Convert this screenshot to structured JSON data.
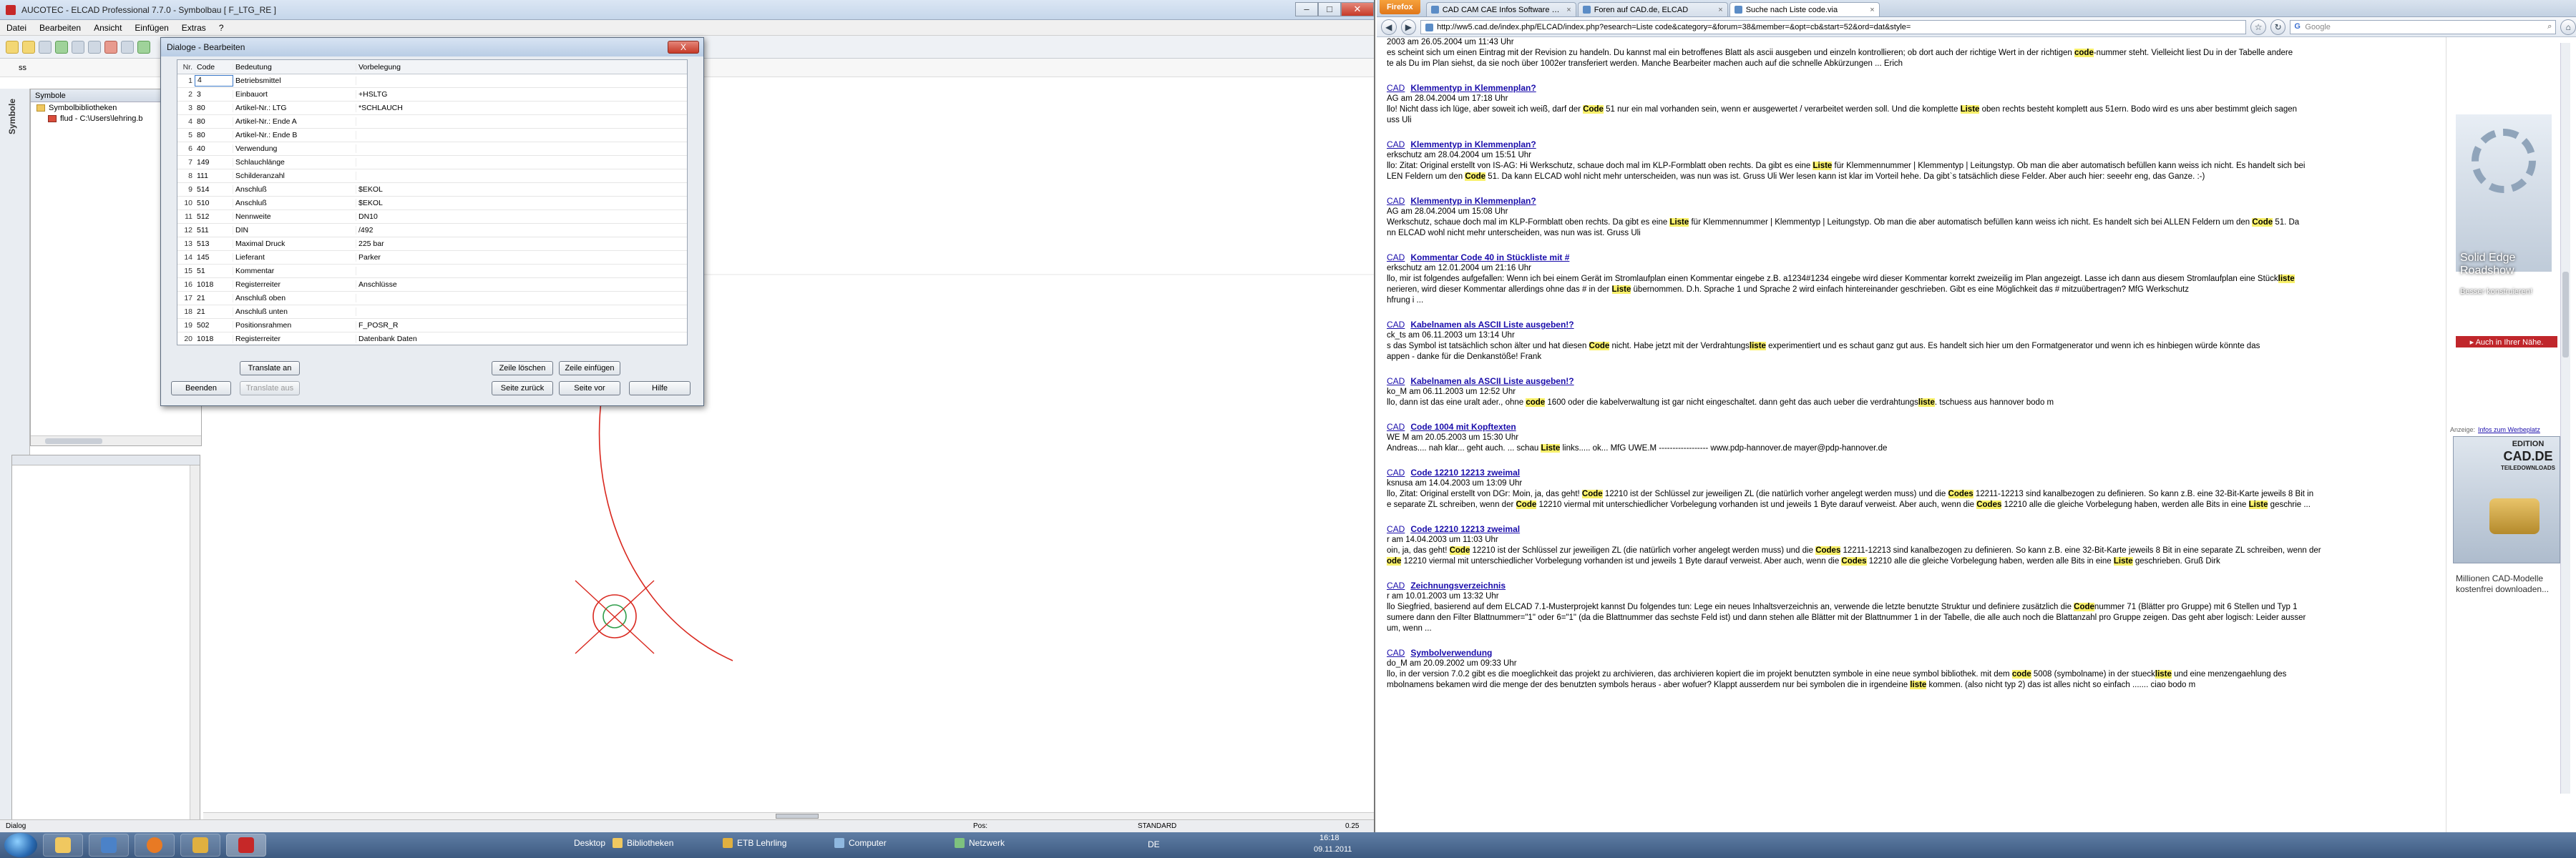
{
  "elcad": {
    "title": "AUCOTEC - ELCAD Professional 7.7.0 - Symbolbau [ F_LTG_RE ]",
    "menu": [
      "Datei",
      "Bearbeiten",
      "Ansicht",
      "Einfügen",
      "Extras",
      "?"
    ],
    "search_value": "ss",
    "left_tab": "Symbole",
    "sym_panel_title": "Symbole",
    "tree": [
      "Symbolbibliotheken",
      "flud - C:\\Users\\lehring.b"
    ],
    "status_left": "Dialog",
    "status_mid": "Pos:",
    "status_std": "STANDARD",
    "status_zoom": "0.25"
  },
  "dialog": {
    "title": "Dialoge - Bearbeiten",
    "close_label": "X",
    "columns": [
      "Nr.",
      "Code",
      "Bedeutung",
      "Vorbelegung"
    ],
    "rows": [
      {
        "nr": "1",
        "code": "4",
        "bed": "Betriebsmittel",
        "vor": ""
      },
      {
        "nr": "2",
        "code": "3",
        "bed": "Einbauort",
        "vor": "+HSLTG"
      },
      {
        "nr": "3",
        "code": "80",
        "bed": "Artikel-Nr.: LTG",
        "vor": "*SCHLAUCH"
      },
      {
        "nr": "4",
        "code": "80",
        "bed": "Artikel-Nr.: Ende A",
        "vor": ""
      },
      {
        "nr": "5",
        "code": "80",
        "bed": "Artikel-Nr.: Ende B",
        "vor": ""
      },
      {
        "nr": "6",
        "code": "40",
        "bed": "Verwendung",
        "vor": ""
      },
      {
        "nr": "7",
        "code": "149",
        "bed": "Schlauchlänge",
        "vor": ""
      },
      {
        "nr": "8",
        "code": "111",
        "bed": "Schilderanzahl",
        "vor": ""
      },
      {
        "nr": "9",
        "code": "514",
        "bed": "Anschluß",
        "vor": "$EKOL"
      },
      {
        "nr": "10",
        "code": "510",
        "bed": "Anschluß",
        "vor": "$EKOL"
      },
      {
        "nr": "11",
        "code": "512",
        "bed": "Nennweite",
        "vor": "DN10"
      },
      {
        "nr": "12",
        "code": "511",
        "bed": "DIN",
        "vor": "/492"
      },
      {
        "nr": "13",
        "code": "513",
        "bed": "Maximal Druck",
        "vor": "225 bar"
      },
      {
        "nr": "14",
        "code": "145",
        "bed": "Lieferant",
        "vor": "Parker"
      },
      {
        "nr": "15",
        "code": "51",
        "bed": "Kommentar",
        "vor": ""
      },
      {
        "nr": "16",
        "code": "1018",
        "bed": "Registerreiter",
        "vor": "Anschlüsse"
      },
      {
        "nr": "17",
        "code": "21",
        "bed": "Anschluß oben",
        "vor": ""
      },
      {
        "nr": "18",
        "code": "21",
        "bed": "Anschluß unten",
        "vor": ""
      },
      {
        "nr": "19",
        "code": "502",
        "bed": "Positionsrahmen",
        "vor": "F_POSR_R"
      },
      {
        "nr": "20",
        "code": "1018",
        "bed": "Registerreiter",
        "vor": "Datenbank Daten"
      }
    ],
    "buttons": {
      "translate_an": "Translate an",
      "zeile_loeschen": "Zeile löschen",
      "zeile_einfuegen": "Zeile einfügen",
      "beenden": "Beenden",
      "translate_aus": "Translate aus",
      "seite_zurueck": "Seite zurück",
      "seite_vor": "Seite vor",
      "hilfe": "Hilfe"
    }
  },
  "browser": {
    "firefox_label": "Firefox",
    "tabs": [
      {
        "label": "CAD CAM CAE Infos Software und Fo...",
        "active": false
      },
      {
        "label": "Foren auf CAD.de, ELCAD",
        "active": false
      },
      {
        "label": "Suche nach Liste code.via",
        "active": true
      }
    ],
    "url": "http://ww5.cad.de/index.php/ELCAD/index.php?esearch=Liste code&category=&forum=38&member=&opt=cb&start=52&ord=dat&style=",
    "search_placeholder": "Google",
    "results": [
      {
        "src": "",
        "link": "",
        "meta": "2003 am 26.05.2004 um 11:43 Uhr",
        "body": [
          [
            {
              "t": "es scheint sich um einen Eintrag mit der Revision zu handeln. Du kannst mal ein betroffenes Blatt als ascii ausgeben und einzeln kontrollieren; ob dort auch der richtige Wert in der richtigen "
            },
            {
              "t": "code",
              "h": true
            },
            {
              "t": "-nummer steht. Vielleicht liest Du in der Tabelle andere"
            }
          ],
          [
            {
              "t": "te als Du im Plan siehst, da sie noch über 1002er transferiert werden. Manche Bearbeiter machen auch auf die schnelle Abkürzungen ... Erich"
            }
          ]
        ]
      },
      {
        "src": "CAD",
        "link": "Klemmentyp in Klemmenplan?",
        "meta": "AG am 28.04.2004 um 17:18 Uhr",
        "body": [
          [
            {
              "t": "llo! Nicht dass ich lüge, aber soweit ich weiß, darf der "
            },
            {
              "t": "Code",
              "h": true
            },
            {
              "t": " 51 nur ein mal vorhanden sein, wenn er ausgewertet / verarbeitet werden soll. Und die komplette "
            },
            {
              "t": "Liste",
              "h": true
            },
            {
              "t": " oben rechts besteht komplett aus 51ern. Bodo wird es uns aber bestimmt gleich sagen"
            }
          ],
          [
            {
              "t": "uss Uli"
            }
          ]
        ]
      },
      {
        "src": "CAD",
        "link": "Klemmentyp in Klemmenplan?",
        "meta": "erkschutz am 28.04.2004 um 15:51 Uhr",
        "body": [
          [
            {
              "t": "llo: Zitat: Original erstellt von IS-AG: Hi Werkschutz, schaue doch mal im KLP-Formblatt oben rechts.  Da gibt es eine "
            },
            {
              "t": "Liste",
              "h": true
            },
            {
              "t": " für Klemmennummer | Klemmentyp | Leitungstyp. Ob man die aber automatisch befüllen kann weiss ich nicht. Es handelt sich bei"
            }
          ],
          [
            {
              "t": "LEN Feldern um den "
            },
            {
              "t": "Code",
              "h": true
            },
            {
              "t": " 51. Da kann ELCAD wohl nicht mehr unterscheiden, was nun was ist. Gruss Uli Wer lesen kann ist klar im Vorteil hehe. Da gibt`s tatsächlich diese Felder. Aber auch hier: seeehr eng, das Ganze. :-)"
            }
          ]
        ]
      },
      {
        "src": "CAD",
        "link": "Klemmentyp in Klemmenplan?",
        "meta": "AG am 28.04.2004 um 15:08 Uhr",
        "body": [
          [
            {
              "t": "Werkschutz, schaue doch mal im KLP-Formblatt oben rechts.  Da gibt es eine "
            },
            {
              "t": "Liste",
              "h": true
            },
            {
              "t": " für Klemmennummer | Klemmentyp | Leitungstyp. Ob man die aber automatisch befüllen kann weiss ich nicht. Es handelt sich bei ALLEN Feldern um den "
            },
            {
              "t": "Code",
              "h": true
            },
            {
              "t": " 51. Da"
            }
          ],
          [
            {
              "t": "nn ELCAD wohl nicht mehr unterscheiden, was nun was ist. Gruss Uli"
            }
          ]
        ]
      },
      {
        "src": "CAD",
        "link": "Kommentar Code 40 in Stückliste mit #",
        "meta": "erkschutz am 12.01.2004 um 21:16 Uhr",
        "body": [
          [
            {
              "t": "llo, mir ist folgendes aufgefallen: Wenn ich bei einem Gerät im Stromlaufplan einen Kommentar eingebe z.B. a1234#1234 eingebe wird dieser Kommentar korrekt zweizeilig im Plan angezeigt. Lasse ich dann aus diesem Stromlaufplan eine Stück"
            },
            {
              "t": "liste",
              "h": true
            }
          ],
          [
            {
              "t": "nerieren, wird dieser Kommentar allerdings ohne das # in der "
            },
            {
              "t": "Liste",
              "h": true
            },
            {
              "t": " übernommen. D.h. Sprache 1 und Sprache 2 wird einfach hintereinander geschrieben. Gibt es eine Möglichkeit das # mitzuübertragen? MfG Werkschutz"
            }
          ],
          [
            {
              "t": "hfrung i ..."
            }
          ]
        ]
      },
      {
        "src": "CAD",
        "link": "Kabelnamen als ASCII Liste ausgeben!?",
        "meta": "ck_ts am 06.11.2003 um 13:14 Uhr",
        "body": [
          [
            {
              "t": "s das Symbol ist tatsächlich schon älter und hat diesen "
            },
            {
              "t": "Code",
              "h": true
            },
            {
              "t": " nicht. Habe jetzt mit der Verdrahtungs"
            },
            {
              "t": "liste",
              "h": true
            },
            {
              "t": " experimentiert und es schaut ganz gut aus. Es handelt sich hier um den Formatgenerator und wenn ich es hinbiegen würde könnte das"
            }
          ],
          [
            {
              "t": "appen - danke für die Denkanstöße! Frank"
            }
          ]
        ]
      },
      {
        "src": "CAD",
        "link": "Kabelnamen als ASCII Liste ausgeben!?",
        "meta": "ko_M am 06.11.2003 um 12:52 Uhr",
        "body": [
          [
            {
              "t": "llo, dann ist das eine uralt ader., ohne "
            },
            {
              "t": "code",
              "h": true
            },
            {
              "t": " 1600 oder die kabelverwaltung ist gar nicht eingeschaltet. dann geht das auch ueber die verdrahtungs"
            },
            {
              "t": "liste",
              "h": true
            },
            {
              "t": ". tschuess aus hannover bodo m"
            }
          ]
        ]
      },
      {
        "src": "CAD",
        "link": "Code 1004 mit Kopftexten",
        "meta": "WE M am 20.05.2003 um 15:30 Uhr",
        "body": [
          [
            {
              "t": "Andreas.... nah klar... geht auch. ... schau "
            },
            {
              "t": "Liste",
              "h": true
            },
            {
              "t": " links..... ok... MfG UWE.M ------------------ www.pdp-hannover.de mayer@pdp-hannover.de"
            }
          ]
        ]
      },
      {
        "src": "CAD",
        "link": "Code 12210 12213 zweimal",
        "meta": "ksnusa am 14.04.2003 um 13:09 Uhr",
        "body": [
          [
            {
              "t": "llo, Zitat: Original erstellt von DGr: Moin, ja, das geht! "
            },
            {
              "t": "Code",
              "h": true
            },
            {
              "t": " 12210 ist der Schlüssel zur jeweiligen ZL (die natürlich vorher angelegt werden muss) und die "
            },
            {
              "t": "Codes",
              "h": true
            },
            {
              "t": " 12211-12213 sind kanalbezogen zu definieren. So kann z.B. eine 32-Bit-Karte jeweils 8 Bit in"
            }
          ],
          [
            {
              "t": "e separate ZL schreiben, wenn der "
            },
            {
              "t": "Code",
              "h": true
            },
            {
              "t": " 12210 viermal mit unterschiedlicher Vorbelegung vorhanden ist und jeweils 1 Byte darauf verweist. Aber auch, wenn die "
            },
            {
              "t": "Codes",
              "h": true
            },
            {
              "t": " 12210 alle die gleiche Vorbelegung haben, werden alle Bits in eine "
            },
            {
              "t": "Liste",
              "h": true
            },
            {
              "t": " geschrie ..."
            }
          ]
        ]
      },
      {
        "src": "CAD",
        "link": "Code 12210 12213 zweimal",
        "meta": "r am 14.04.2003 um 11:03 Uhr",
        "body": [
          [
            {
              "t": "oin, ja, das geht! "
            },
            {
              "t": "Code",
              "h": true
            },
            {
              "t": " 12210 ist der Schlüssel zur jeweiligen ZL (die natürlich vorher angelegt werden muss) und die "
            },
            {
              "t": "Codes",
              "h": true
            },
            {
              "t": " 12211-12213 sind kanalbezogen zu definieren. So kann z.B. eine 32-Bit-Karte jeweils 8 Bit in eine separate ZL schreiben, wenn der"
            }
          ],
          [
            {
              "t": "ode",
              "h": true
            },
            {
              "t": " 12210 viermal mit unterschiedlicher Vorbelegung vorhanden ist und jeweils 1 Byte darauf verweist. Aber auch, wenn die "
            },
            {
              "t": "Codes",
              "h": true
            },
            {
              "t": " 12210 alle die gleiche Vorbelegung haben, werden alle Bits in eine "
            },
            {
              "t": "Liste",
              "h": true
            },
            {
              "t": " geschrieben. Gruß Dirk"
            }
          ]
        ]
      },
      {
        "src": "CAD",
        "link": "Zeichnungsverzeichnis",
        "meta": "r am 10.01.2003 um 13:32 Uhr",
        "body": [
          [
            {
              "t": "llo Siegfried, basierend auf dem ELCAD 7.1-Musterprojekt kannst Du folgendes tun: Lege ein neues Inhaltsverzeichnis an, verwende die letzte benutzte Struktur und definiere zusätzlich die "
            },
            {
              "t": "Code",
              "h": true
            },
            {
              "t": "nummer 71 (Blätter pro Gruppe) mit 6 Stellen und Typ 1"
            }
          ],
          [
            {
              "t": "sumere dann den Filter Blattnummer=\"1\" oder 6=\"1\" (da die Blattnummer das sechste Feld ist) und dann stehen alle Blätter mit der Blattnummer 1 in der Tabelle, die alle auch noch die Blattanzahl pro Gruppe zeigen. Das geht aber logisch: Leider ausser"
            }
          ],
          [
            {
              "t": "um, wenn ..."
            }
          ]
        ]
      },
      {
        "src": "CAD",
        "link": "Symbolverwendung",
        "meta": "do_M am 20.09.2002 um 09:33 Uhr",
        "body": [
          [
            {
              "t": "llo, in der version 7.0.2 gibt es die moeglichkeit das projekt zu archivieren, das archivieren kopiert die im projekt benutzten symbole in eine neue symbol bibliothek. mit dem "
            },
            {
              "t": "code",
              "h": true
            },
            {
              "t": " 5008 (symbolname) in der stueck"
            },
            {
              "t": "liste",
              "h": true
            },
            {
              "t": " und eine menzengaehlung des"
            }
          ],
          [
            {
              "t": "mbolnamens bekamen wird die menge der des benutzten symbols heraus - aber wofuer? Klappt ausserdem nur bei symbolen die in irgendeine "
            },
            {
              "t": "liste",
              "h": true
            },
            {
              "t": " kommen. (also nicht typ 2) das ist alles nicht so einfach ....... ciao bodo m"
            }
          ]
        ]
      }
    ],
    "ad1": {
      "headline": "Solid Edge Roadshow",
      "sub": "Besser konstruieren!",
      "cta": "▸ Auch in Ihrer Nähe."
    },
    "ad2": {
      "label": "Anzeige:",
      "label_link": "Infos zum Werbeplatz",
      "edition_line1": "EDITION",
      "edition_line2": "CAD.DE",
      "edition_line3": "TEILEDOWNLOADS",
      "text": "Millionen CAD-Modelle kostenfrei downloaden..."
    }
  },
  "taskbar": {
    "desktop": "Desktop",
    "items": [
      "Bibliotheken",
      "ETB Lehrling",
      "Computer",
      "Netzwerk"
    ],
    "lang": "DE",
    "time": "16:18",
    "date": "09.11.2011"
  },
  "colors": {
    "highlight": "#f8f06a",
    "link": "#1a0dab",
    "drawing_red": "#d9281f",
    "drawing_green": "#2e9d4a"
  }
}
